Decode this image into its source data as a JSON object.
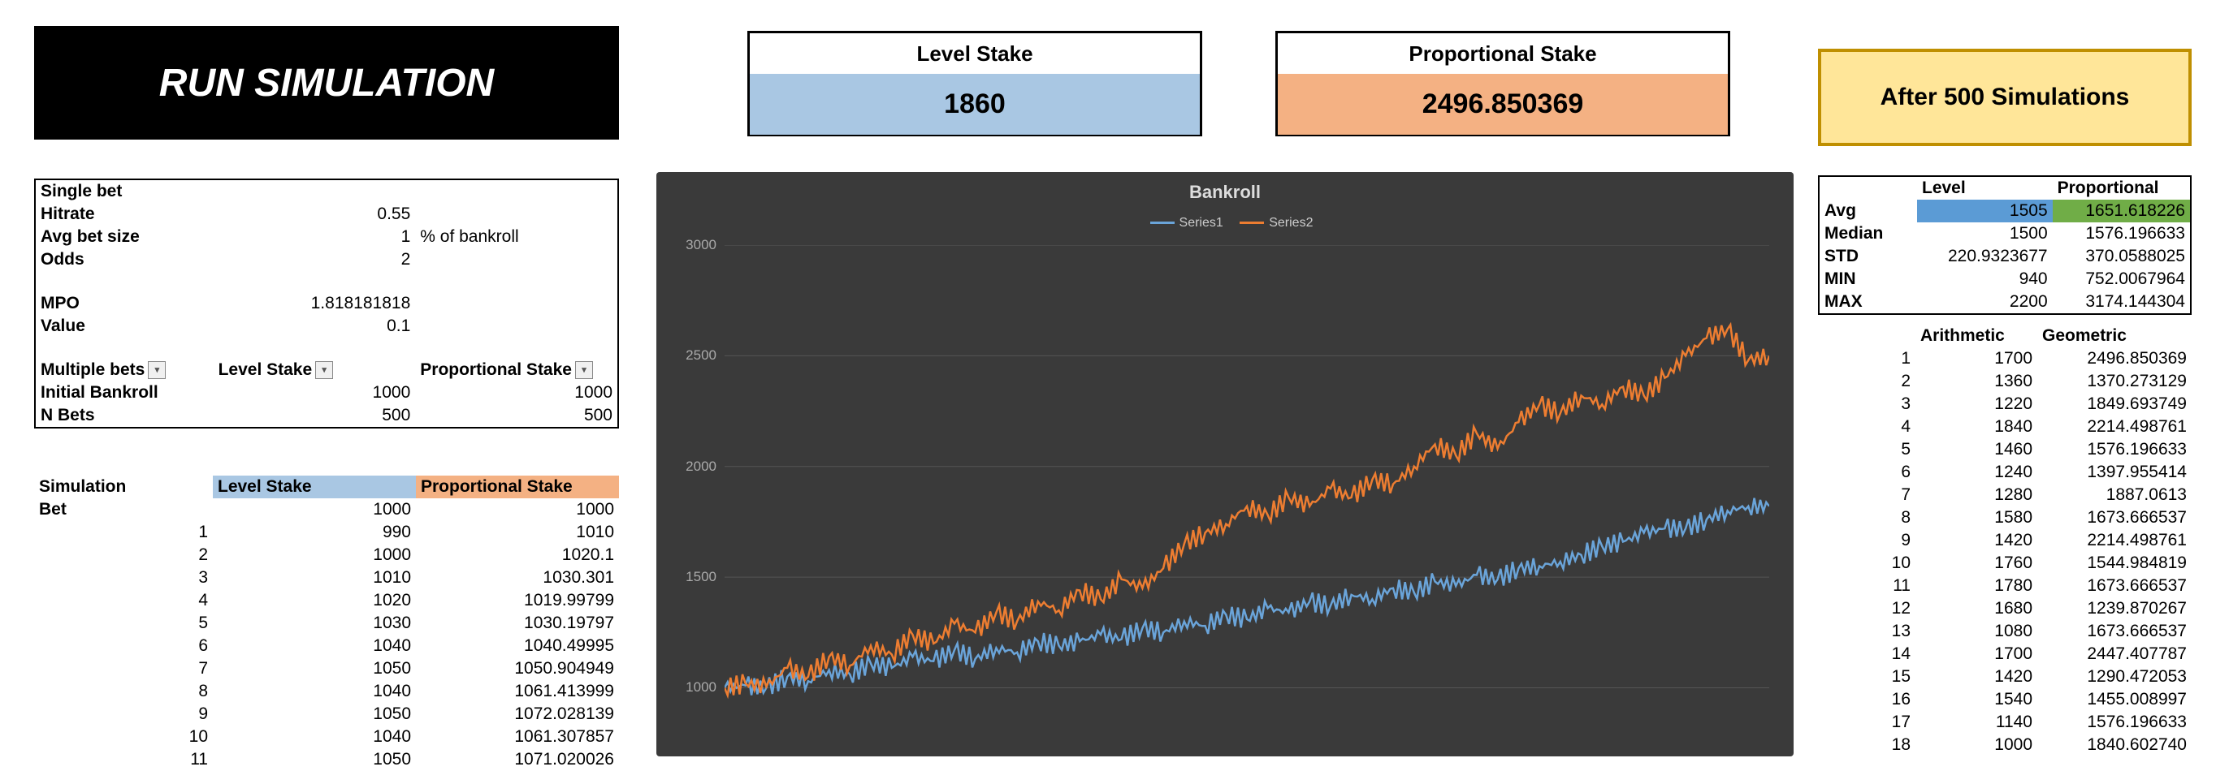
{
  "run_button": "RUN SIMULATION",
  "kpi": {
    "level": {
      "label": "Level Stake",
      "value": "1860"
    },
    "prop": {
      "label": "Proportional Stake",
      "value": "2496.850369"
    }
  },
  "after_sim_title": "After 500 Simulations",
  "params": {
    "single_bet": "Single bet",
    "hitrate": {
      "label": "Hitrate",
      "value": "0.55"
    },
    "avg_bet": {
      "label": "Avg bet size",
      "value": "1",
      "unit": "% of bankroll"
    },
    "odds": {
      "label": "Odds",
      "value": "2"
    },
    "mpo": {
      "label": "MPO",
      "value": "1.818181818"
    },
    "val": {
      "label": "Value",
      "value": "0.1"
    },
    "multi": {
      "c0": "Multiple bets",
      "c1": "Level Stake",
      "c2": "Proportional Stake"
    },
    "initial": {
      "label": "Initial Bankroll",
      "level": "1000",
      "prop": "1000"
    },
    "nbets": {
      "label": "N Bets",
      "level": "500",
      "prop": "500"
    }
  },
  "sim_header": {
    "c0": "Simulation",
    "c1": "Level Stake",
    "c2": "Proportional Stake"
  },
  "bet_label": "Bet",
  "bet_initial": {
    "level": "1000",
    "prop": "1000"
  },
  "sim_rows": [
    {
      "n": "1",
      "level": "990",
      "prop": "1010"
    },
    {
      "n": "2",
      "level": "1000",
      "prop": "1020.1"
    },
    {
      "n": "3",
      "level": "1010",
      "prop": "1030.301"
    },
    {
      "n": "4",
      "level": "1020",
      "prop": "1019.99799"
    },
    {
      "n": "5",
      "level": "1030",
      "prop": "1030.19797"
    },
    {
      "n": "6",
      "level": "1040",
      "prop": "1040.49995"
    },
    {
      "n": "7",
      "level": "1050",
      "prop": "1050.904949"
    },
    {
      "n": "8",
      "level": "1040",
      "prop": "1061.413999"
    },
    {
      "n": "9",
      "level": "1050",
      "prop": "1072.028139"
    },
    {
      "n": "10",
      "level": "1040",
      "prop": "1061.307857"
    },
    {
      "n": "11",
      "level": "1050",
      "prop": "1071.020026"
    }
  ],
  "stats": {
    "headers": {
      "level": "Level",
      "prop": "Proportional"
    },
    "rows": [
      {
        "label": "Avg",
        "level": "1505",
        "prop": "1651.618226",
        "highlight": true
      },
      {
        "label": "Median",
        "level": "1500",
        "prop": "1576.196633"
      },
      {
        "label": "STD",
        "level": "220.9323677",
        "prop": "370.0588025"
      },
      {
        "label": "MIN",
        "level": "940",
        "prop": "752.0067964"
      },
      {
        "label": "MAX",
        "level": "2200",
        "prop": "3174.144304"
      }
    ]
  },
  "runs_header": {
    "arith": "Arithmetic",
    "geom": "Geometric"
  },
  "runs": [
    {
      "n": "1",
      "a": "1700",
      "g": "2496.850369"
    },
    {
      "n": "2",
      "a": "1360",
      "g": "1370.273129"
    },
    {
      "n": "3",
      "a": "1220",
      "g": "1849.693749"
    },
    {
      "n": "4",
      "a": "1840",
      "g": "2214.498761"
    },
    {
      "n": "5",
      "a": "1460",
      "g": "1576.196633"
    },
    {
      "n": "6",
      "a": "1240",
      "g": "1397.955414"
    },
    {
      "n": "7",
      "a": "1280",
      "g": "1887.0613"
    },
    {
      "n": "8",
      "a": "1580",
      "g": "1673.666537"
    },
    {
      "n": "9",
      "a": "1420",
      "g": "2214.498761"
    },
    {
      "n": "10",
      "a": "1760",
      "g": "1544.984819"
    },
    {
      "n": "11",
      "a": "1780",
      "g": "1673.666537"
    },
    {
      "n": "12",
      "a": "1680",
      "g": "1239.870267"
    },
    {
      "n": "13",
      "a": "1080",
      "g": "1673.666537"
    },
    {
      "n": "14",
      "a": "1700",
      "g": "2447.407787"
    },
    {
      "n": "15",
      "a": "1420",
      "g": "1290.472053"
    },
    {
      "n": "16",
      "a": "1540",
      "g": "1455.008997"
    },
    {
      "n": "17",
      "a": "1140",
      "g": "1576.196633"
    },
    {
      "n": "18",
      "a": "1000",
      "g": "1840.602740"
    }
  ],
  "chart_data": {
    "type": "line",
    "title": "Bankroll",
    "series_labels": [
      "Series1",
      "Series2"
    ],
    "colors": [
      "#6aa4d9",
      "#ed7d31"
    ],
    "ylabel": "",
    "xlabel": "",
    "ylim": [
      800,
      3000
    ],
    "yticks": [
      1000,
      1500,
      2000,
      2500,
      3000
    ],
    "x": [
      0,
      10,
      20,
      30,
      40,
      50,
      60,
      70,
      80,
      90,
      100,
      110,
      120,
      130,
      140,
      150,
      160,
      170,
      180,
      190,
      200,
      210,
      220,
      230,
      240,
      250,
      260,
      270,
      280,
      290,
      300,
      310,
      320,
      330,
      340,
      350,
      360,
      370,
      380,
      390,
      400,
      410,
      420,
      430,
      440,
      450,
      460,
      470,
      480,
      490,
      500
    ],
    "series": [
      {
        "name": "Series1",
        "values": [
          1000,
          1010,
          1000,
          1050,
          1030,
          1080,
          1060,
          1110,
          1090,
          1140,
          1120,
          1170,
          1130,
          1180,
          1160,
          1210,
          1190,
          1210,
          1240,
          1220,
          1270,
          1250,
          1300,
          1280,
          1330,
          1310,
          1360,
          1340,
          1390,
          1370,
          1420,
          1400,
          1450,
          1430,
          1480,
          1460,
          1510,
          1490,
          1540,
          1550,
          1570,
          1600,
          1640,
          1660,
          1700,
          1720,
          1720,
          1760,
          1800,
          1820,
          1820
        ]
      },
      {
        "name": "Series2",
        "values": [
          1000,
          1020,
          1005,
          1090,
          1050,
          1140,
          1100,
          1190,
          1150,
          1240,
          1200,
          1290,
          1250,
          1340,
          1300,
          1390,
          1350,
          1440,
          1400,
          1490,
          1450,
          1540,
          1650,
          1700,
          1740,
          1820,
          1780,
          1860,
          1820,
          1900,
          1860,
          1940,
          1920,
          2000,
          2100,
          2050,
          2150,
          2080,
          2200,
          2280,
          2240,
          2320,
          2280,
          2360,
          2320,
          2400,
          2500,
          2580,
          2620,
          2480,
          2500
        ]
      }
    ]
  }
}
